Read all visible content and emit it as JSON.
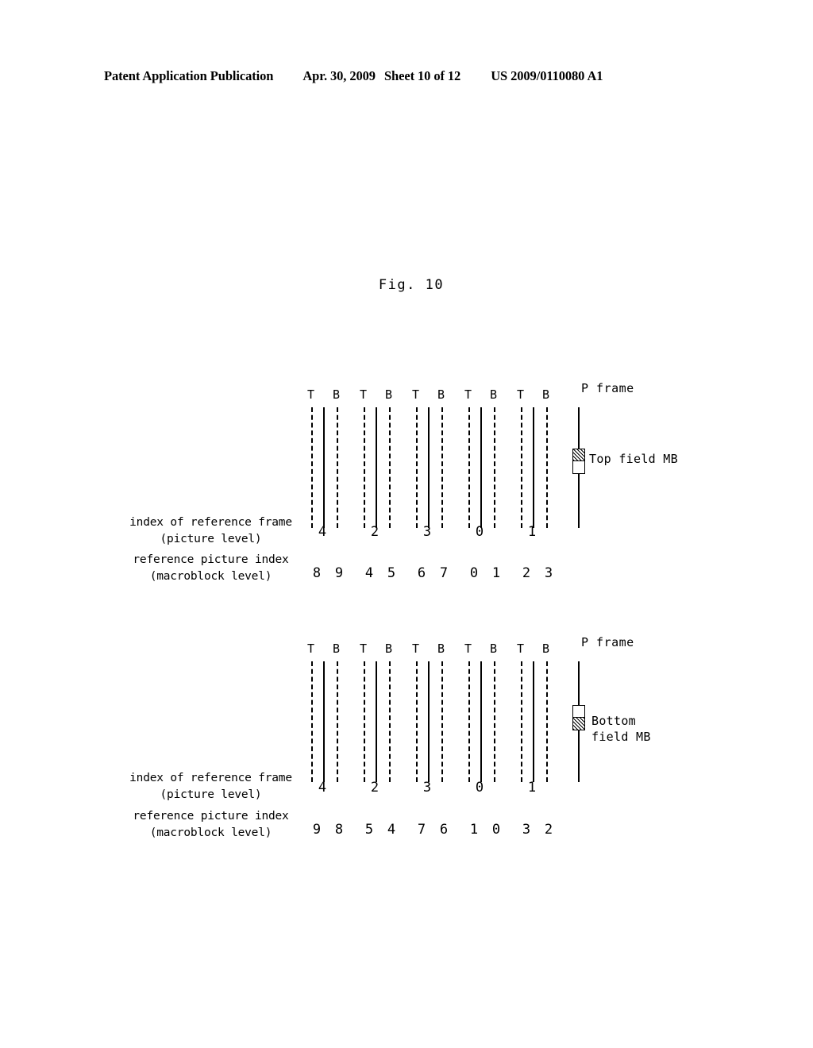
{
  "header": {
    "publication": "Patent Application Publication",
    "date": "Apr. 30, 2009",
    "sheet": "Sheet 10 of 12",
    "patent_number": "US 2009/0110080 A1"
  },
  "figure": {
    "caption": "Fig. 10"
  },
  "labels": {
    "picture_level_line1": "index of reference frame",
    "picture_level_line2": "(picture level)",
    "macroblock_level_line1": "reference picture index",
    "macroblock_level_line2": "(macroblock level)",
    "p_frame": "P frame",
    "field_top": "T",
    "field_bottom": "B"
  },
  "diagrams": [
    {
      "id": "top",
      "marker_label_line1": "Top field MB",
      "marker_label_line2": "",
      "marker_hatched_half": "top",
      "frame_groups": [
        {
          "top": "T",
          "bottom": "B"
        },
        {
          "top": "T",
          "bottom": "B"
        },
        {
          "top": "T",
          "bottom": "B"
        },
        {
          "top": "T",
          "bottom": "B"
        },
        {
          "top": "T",
          "bottom": "B"
        }
      ],
      "picture_level_indices": [
        "4",
        "2",
        "3",
        "0",
        "1"
      ],
      "macroblock_level_indices": [
        "8",
        "9",
        "4",
        "5",
        "6",
        "7",
        "0",
        "1",
        "2",
        "3"
      ]
    },
    {
      "id": "bottom",
      "marker_label_line1": "Bottom",
      "marker_label_line2": "field MB",
      "marker_hatched_half": "bottom",
      "frame_groups": [
        {
          "top": "T",
          "bottom": "B"
        },
        {
          "top": "T",
          "bottom": "B"
        },
        {
          "top": "T",
          "bottom": "B"
        },
        {
          "top": "T",
          "bottom": "B"
        },
        {
          "top": "T",
          "bottom": "B"
        }
      ],
      "picture_level_indices": [
        "4",
        "2",
        "3",
        "0",
        "1"
      ],
      "macroblock_level_indices": [
        "9",
        "8",
        "5",
        "4",
        "7",
        "6",
        "1",
        "0",
        "3",
        "2"
      ]
    }
  ]
}
